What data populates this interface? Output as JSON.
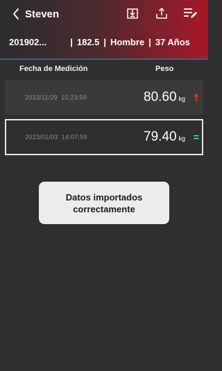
{
  "header": {
    "back_icon": "chevron-left-icon",
    "user_name": "Steven",
    "icons": [
      "download-icon",
      "share-icon",
      "edit-list-icon"
    ]
  },
  "profile": {
    "id": "201902...",
    "height": "182.5",
    "gender": "Hombre",
    "age": "37 Años",
    "separator": "|"
  },
  "table": {
    "date_header": "Fecha de Medición",
    "weight_header": "Peso",
    "rows": [
      {
        "date": "2023/11/29",
        "time": "15:23:59",
        "value": "80.60",
        "unit": "kg",
        "trend": "up",
        "trend_color": "#e0302a"
      },
      {
        "date": "2023/01/03",
        "time": "14:07:59",
        "value": "79.40",
        "unit": "kg",
        "trend": "equal",
        "trend_color": "#2ecc71"
      }
    ]
  },
  "toast": {
    "message": "Datos importados correctamente"
  },
  "colors": {
    "header_gradient_start": "#2c2c2e",
    "header_gradient_end": "#a8182a",
    "background": "#2f2f2f",
    "accent_line": "#3a5f8a"
  }
}
